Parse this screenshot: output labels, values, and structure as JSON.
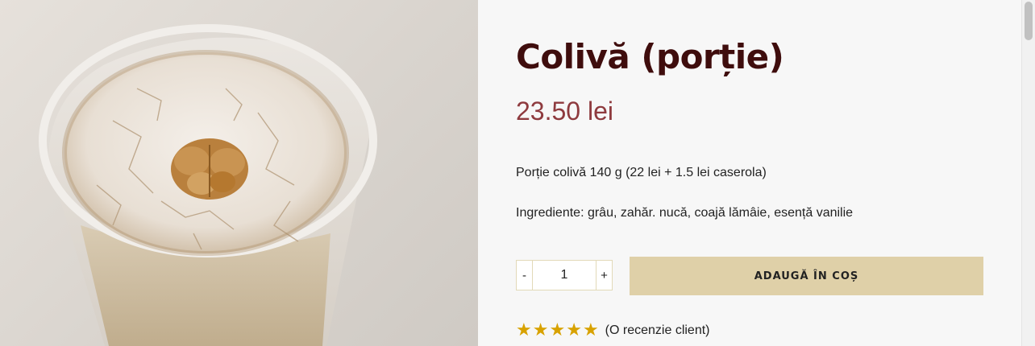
{
  "product": {
    "title": "Colivă (porție)",
    "price": "23.50 lei",
    "description": "Porție colivă 140 g (22 lei + 1.5 lei caserola)",
    "ingredients": "Ingrediente: grâu, zahăr. nucă, coajă lămâie, esență vanilie"
  },
  "cart": {
    "minus_label": "-",
    "plus_label": "+",
    "quantity": "1",
    "add_button_label": "ADAUGĂ ÎN COȘ"
  },
  "rating": {
    "stars": 5,
    "max_stars": 5,
    "review_text": "(O recenzie client)"
  },
  "colors": {
    "title": "#3f0d0d",
    "price": "#8e3a3e",
    "button_bg": "#dfd0a8",
    "star": "#d8a200"
  },
  "image": {
    "alt": "Colivă"
  }
}
